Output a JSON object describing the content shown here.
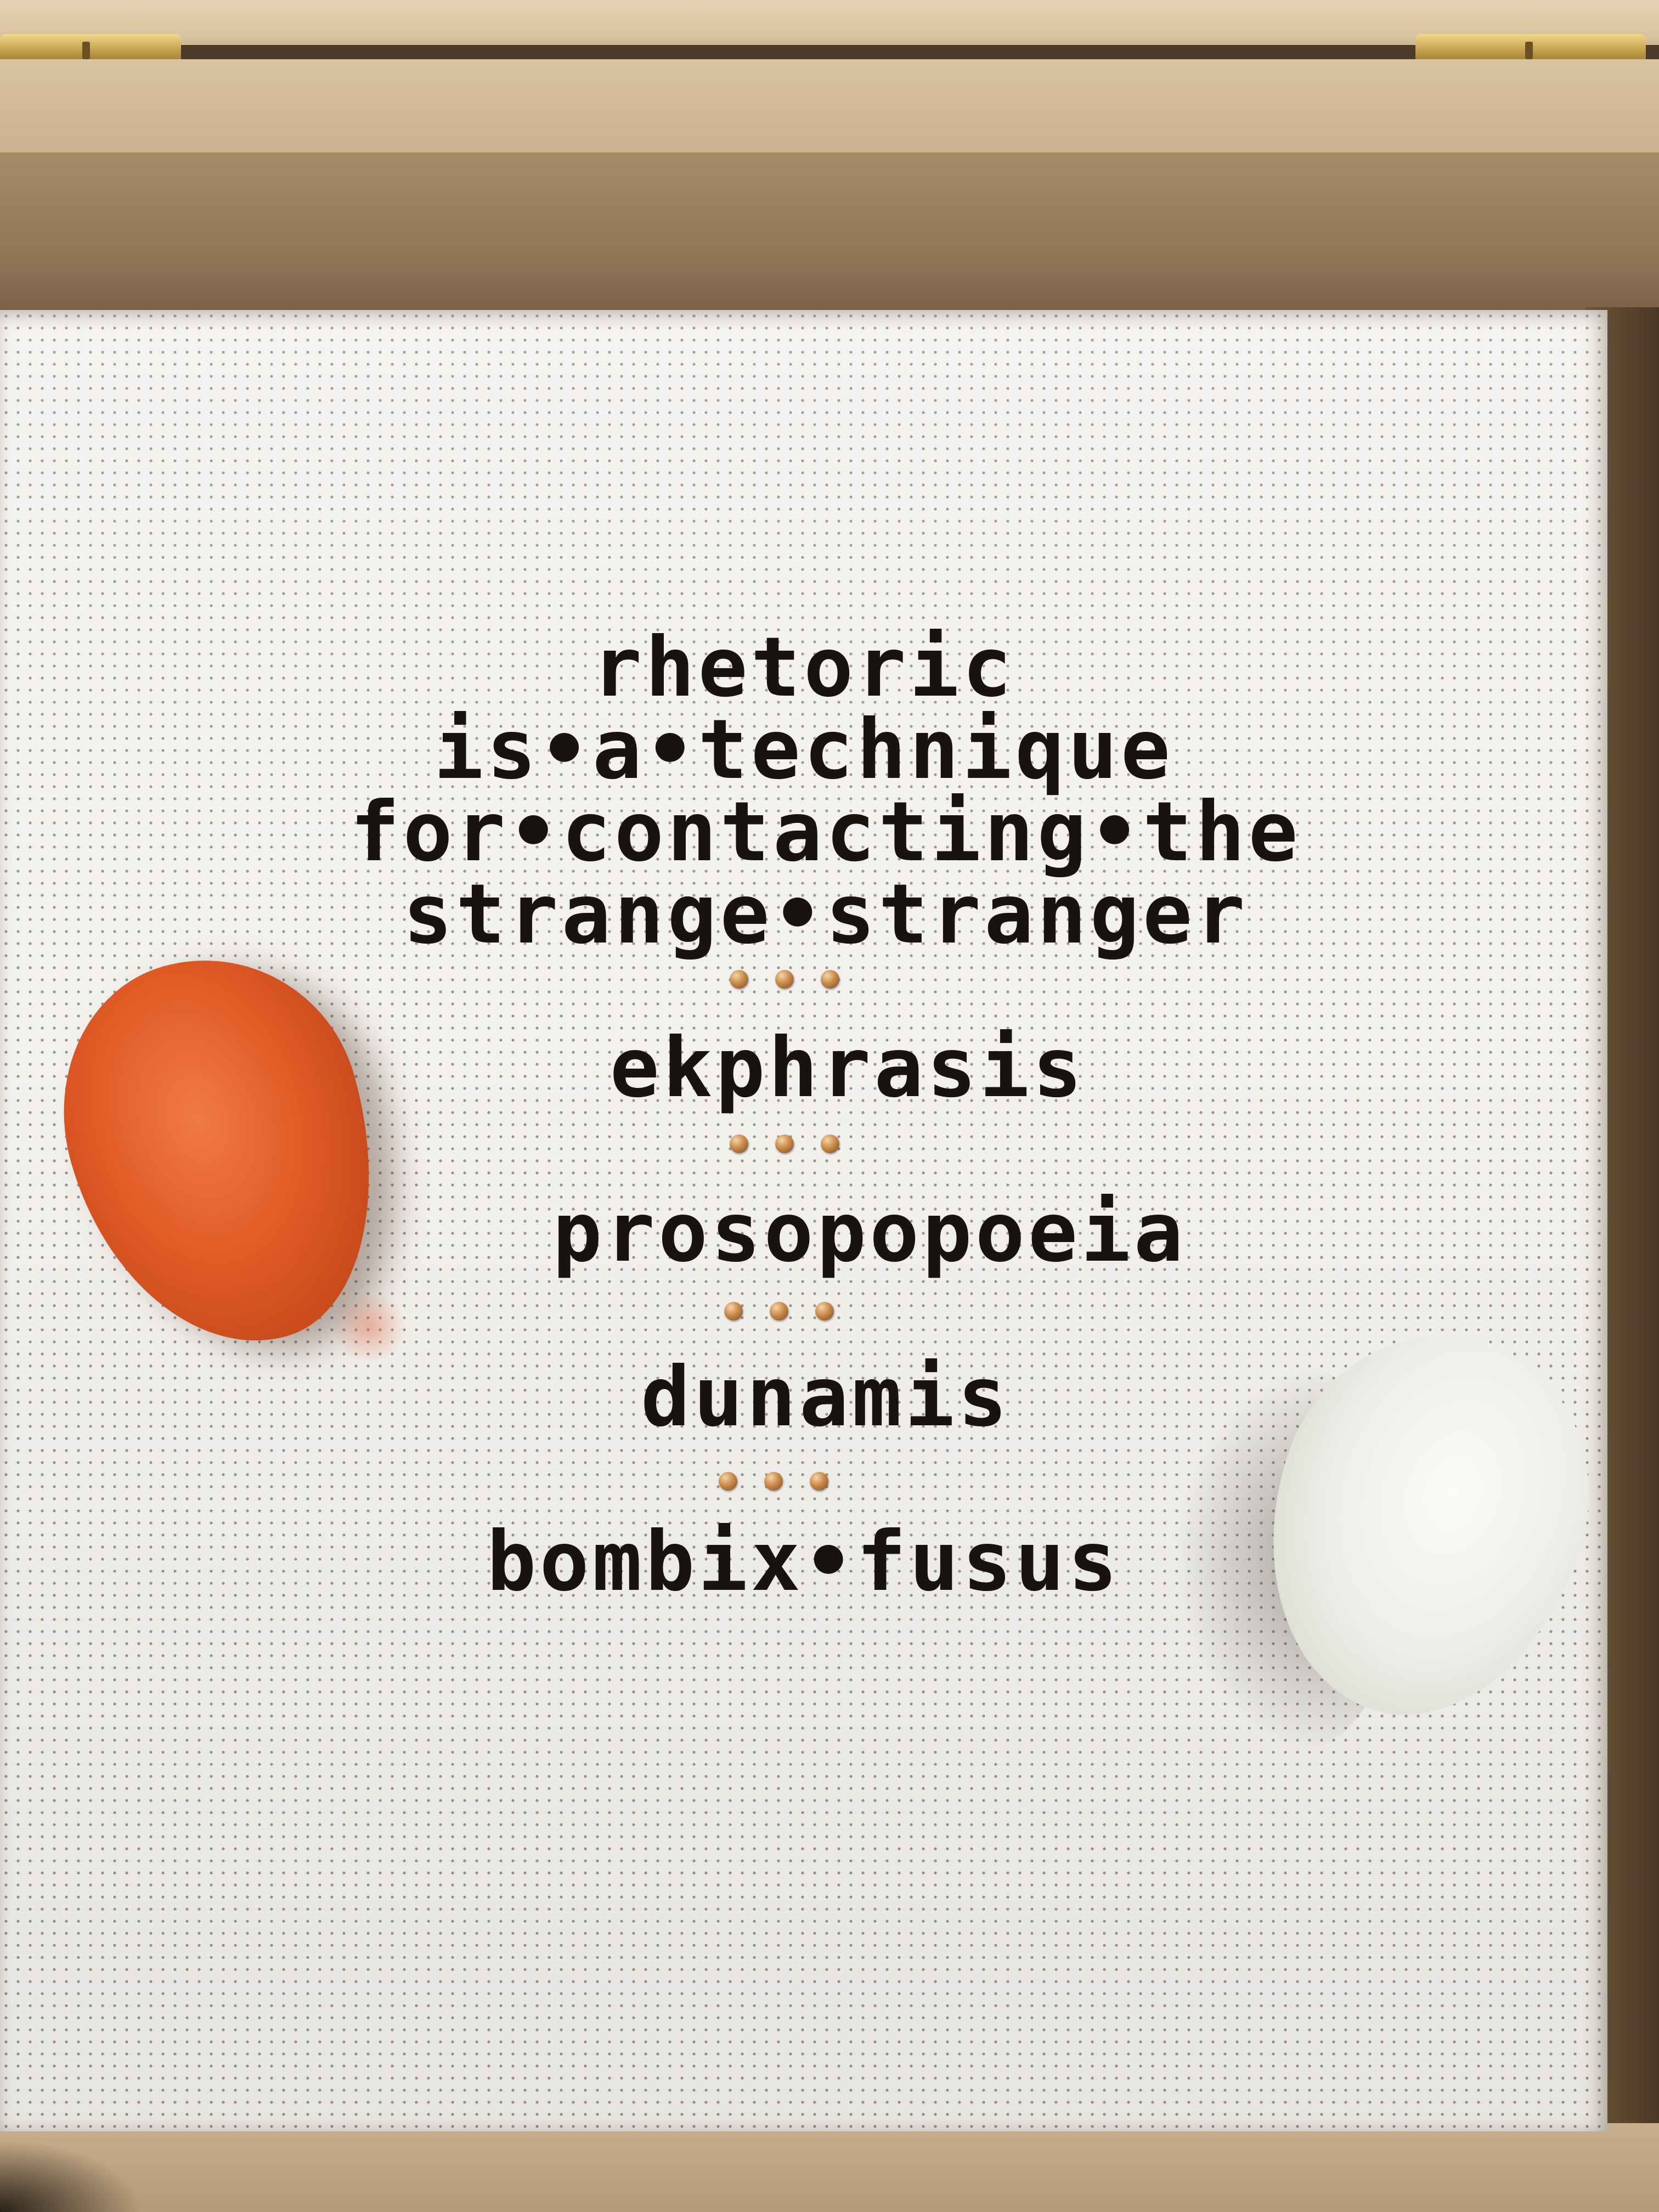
{
  "embroidery": {
    "line_1": "rhetoric",
    "line_2": "is•a•technique",
    "line_3": "for•contacting•the",
    "line_4": "strange•stranger",
    "line_5": "ekphrasis",
    "line_6": "prosopopoeia",
    "line_7": "dunamis",
    "line_8": "bombix•fusus"
  },
  "colors": {
    "thread": "#17130f",
    "cloth": "#f3f1ee",
    "bead": "#c98a4a",
    "cocoon_orange": "#e05a25",
    "cocoon_white": "#eeeee8",
    "wood": "#cbb18c"
  }
}
